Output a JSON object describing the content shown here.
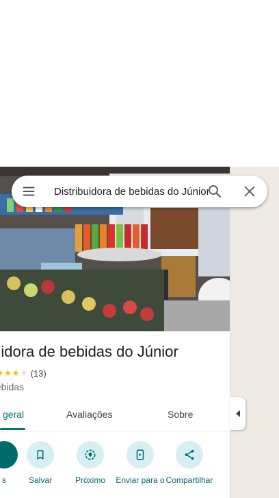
{
  "search": {
    "query": "Distribuidora de bebidas do Júnior"
  },
  "place": {
    "title": "ibuidora de bebidas do Júnior",
    "rating": 3.6,
    "review_count": "(13)",
    "category": "bebidas"
  },
  "tabs": [
    {
      "label": "geral",
      "active": true
    },
    {
      "label": "Avaliações",
      "active": false
    },
    {
      "label": "Sobre",
      "active": false
    }
  ],
  "actions": [
    {
      "label": "s",
      "icon": "directions-icon"
    },
    {
      "label": "Salvar",
      "icon": "bookmark-icon"
    },
    {
      "label": "Próximo",
      "icon": "nearby-icon"
    },
    {
      "label": "Enviar para o",
      "icon": "send-to-phone-icon"
    },
    {
      "label": "Compartilhar",
      "icon": "share-icon"
    }
  ],
  "colors": {
    "accent": "#00796b",
    "action_circle": "#d7eff3",
    "star": "#fbbc04",
    "map": "#efeae3"
  }
}
